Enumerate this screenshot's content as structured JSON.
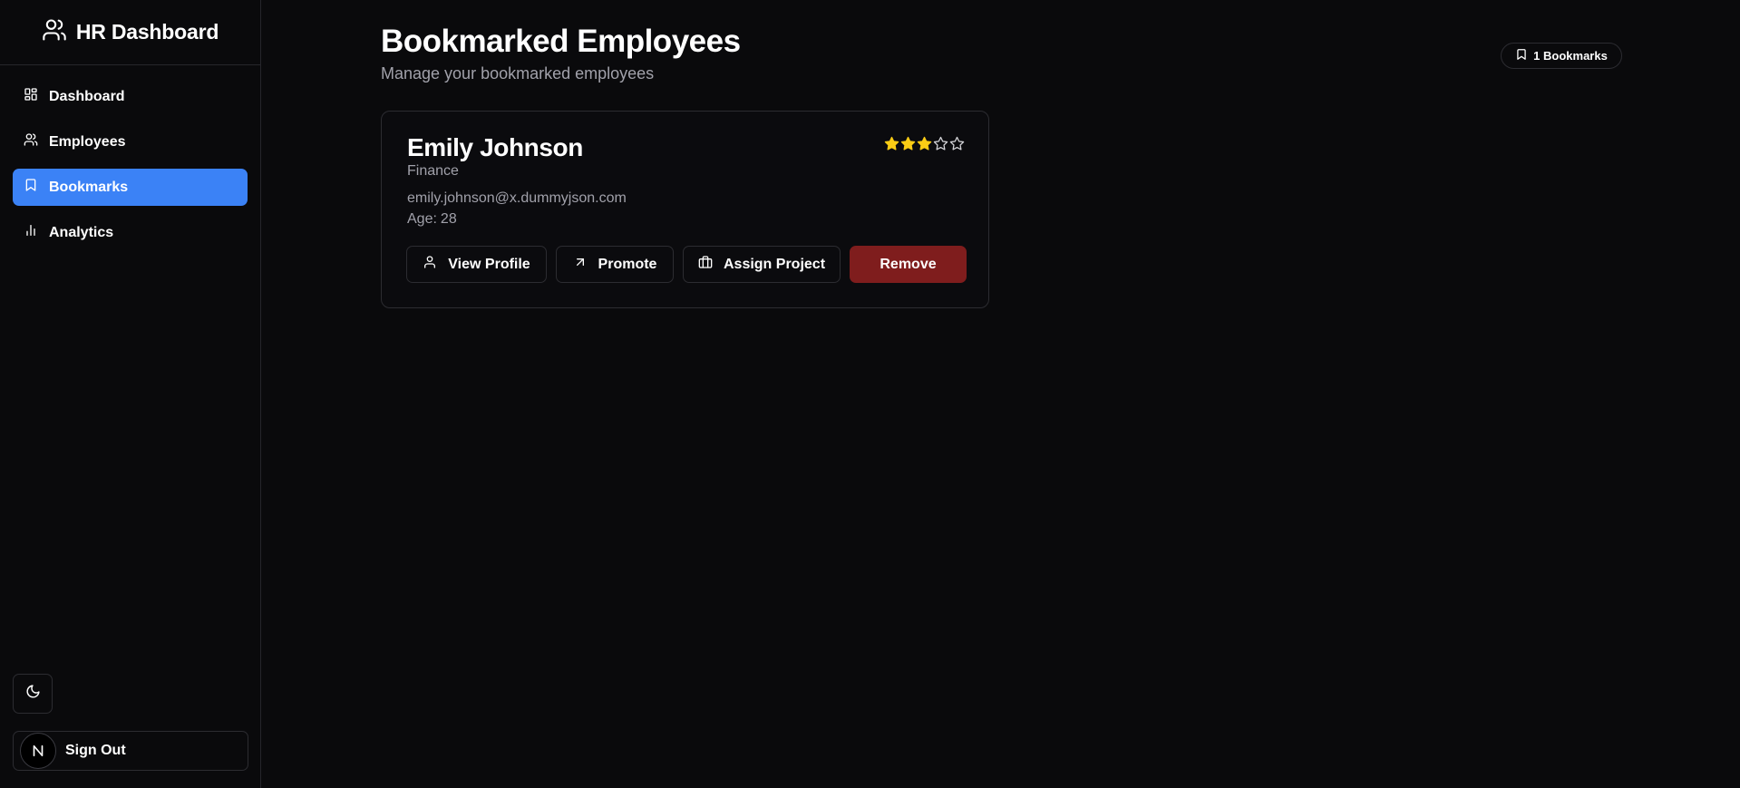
{
  "sidebar": {
    "brand_title": "HR Dashboard",
    "brand_icon": "users-icon",
    "items": [
      {
        "label": "Dashboard",
        "icon": "layout-dashboard-icon",
        "active": false
      },
      {
        "label": "Employees",
        "icon": "users-icon",
        "active": false
      },
      {
        "label": "Bookmarks",
        "icon": "bookmark-icon",
        "active": true
      },
      {
        "label": "Analytics",
        "icon": "bar-chart-icon",
        "active": false
      }
    ],
    "theme_toggle_icon": "moon-icon",
    "signout_label": "Sign Out",
    "avatar_letter": "N"
  },
  "header": {
    "title": "Bookmarked Employees",
    "subtitle": "Manage your bookmarked employees",
    "badge_label": "1 Bookmarks"
  },
  "employees": [
    {
      "name": "Emily Johnson",
      "department": "Finance",
      "email": "emily.johnson@x.dummyjson.com",
      "age_label": "Age:",
      "age": "28",
      "rating": 3,
      "rating_max": 5,
      "actions": {
        "view_profile": "View Profile",
        "promote": "Promote",
        "assign_project": "Assign Project",
        "remove": "Remove"
      }
    }
  ],
  "colors": {
    "background": "#0a0a0c",
    "accent": "#3b82f6",
    "star": "#facc15",
    "danger": "#7f1d1d",
    "muted_text": "#a1a1aa",
    "border": "#2c2c31"
  }
}
